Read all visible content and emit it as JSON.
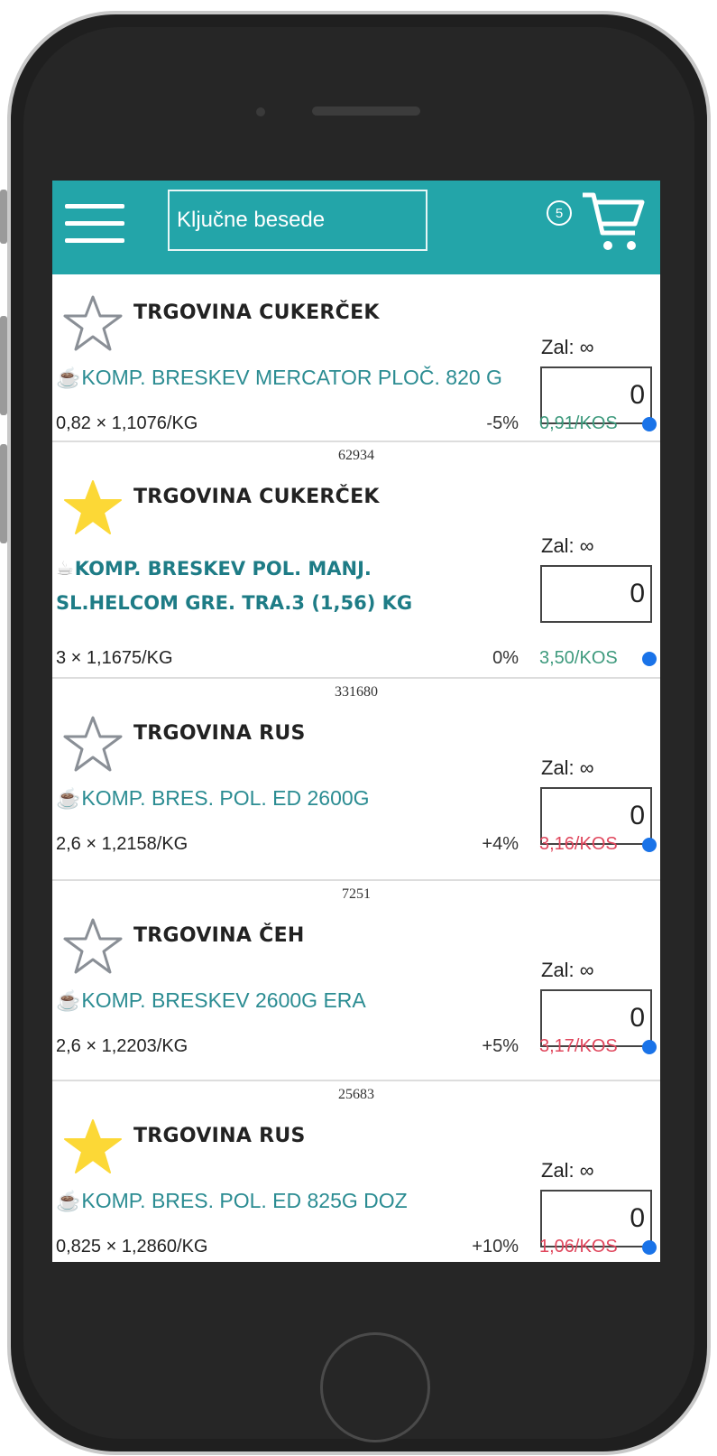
{
  "header": {
    "search_placeholder": "Ključne besede",
    "cart_count": "5"
  },
  "items": [
    {
      "code": "",
      "favorite": false,
      "store": "TRGOVINA CUKERČEK",
      "product": "KOMP. BRESKEV MERCATOR PLOČ. 820 G",
      "product_bold": false,
      "unit": "0,82 × 1,1076/KG",
      "pct": "-5%",
      "price": "0,91/KOS",
      "price_color": "green",
      "stock": "Zal: ∞",
      "qty": "0"
    },
    {
      "code": "62934",
      "favorite": true,
      "store": "TRGOVINA CUKERČEK",
      "product": "KOMP. BRESKEV POL. MANJ.",
      "product_line2": "SL.HELCOM GRE. TRA.3 (1,56) KG",
      "product_bold": true,
      "unit": "3 × 1,1675/KG",
      "pct": "0%",
      "price": "3,50/KOS",
      "price_color": "green",
      "stock": "Zal: ∞",
      "qty": "0"
    },
    {
      "code": "331680",
      "favorite": false,
      "store": "TRGOVINA RUS",
      "product": "KOMP. BRES. POL. ED 2600G",
      "product_bold": false,
      "unit": "2,6 × 1,2158/KG",
      "pct": "+4%",
      "price": "3,16/KOS",
      "price_color": "red",
      "stock": "Zal: ∞",
      "qty": "0"
    },
    {
      "code": "7251",
      "favorite": false,
      "store": "TRGOVINA ČEH",
      "product": "KOMP. BRESKEV 2600G ERA",
      "product_bold": false,
      "unit": "2,6 × 1,2203/KG",
      "pct": "+5%",
      "price": "3,17/KOS",
      "price_color": "red",
      "stock": "Zal: ∞",
      "qty": "0"
    },
    {
      "code": "25683",
      "favorite": true,
      "store": "TRGOVINA RUS",
      "product": "KOMP. BRES. POL. ED 825G DOZ",
      "product_bold": false,
      "unit": "0,825 × 1,2860/KG",
      "pct": "+10%",
      "price": "1,06/KOS",
      "price_color": "red",
      "stock": "Zal: ∞",
      "qty": "0"
    }
  ],
  "colors": {
    "header": "#23a5a9",
    "product": "#2b8c92",
    "star_filled": "#fcd836",
    "price_green": "#3e9a7d",
    "price_red": "#e0475d",
    "dot": "#1a73e8"
  },
  "icons": {
    "menu": "hamburger-icon",
    "cart": "shopping-cart-icon",
    "favorite": "star-icon",
    "product": "mug-icon"
  }
}
